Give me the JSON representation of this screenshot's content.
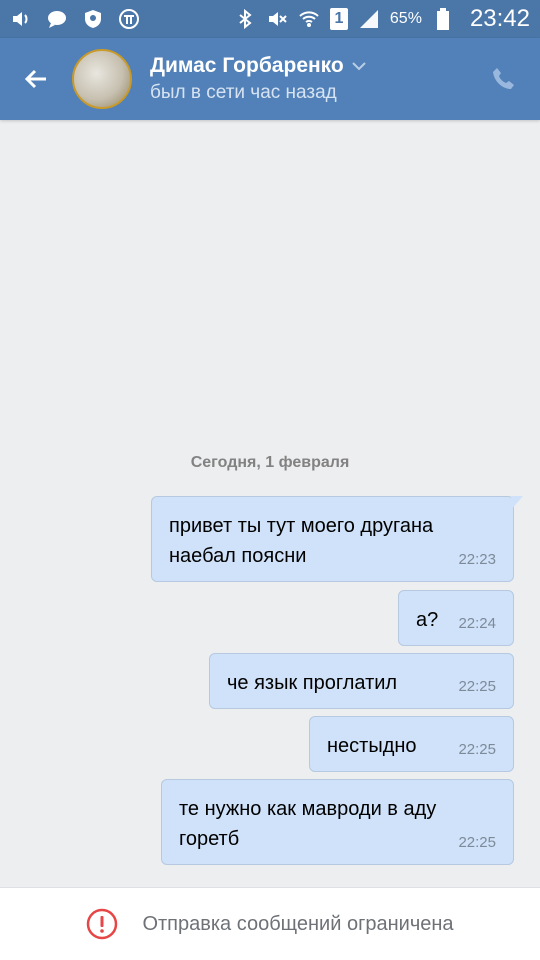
{
  "status_bar": {
    "battery_percent": "65%",
    "time": "23:42",
    "sim_label": "1",
    "icons": [
      "volume-icon",
      "chat-icon",
      "shield-icon",
      "pi-icon",
      "bluetooth-icon",
      "mute-icon",
      "wifi-icon",
      "sim-icon",
      "signal-icon",
      "battery-icon"
    ]
  },
  "header": {
    "contact_name": "Димас Горбаренко",
    "last_seen": "был в сети час назад"
  },
  "chat": {
    "date_separator": "Сегодня, 1 февраля",
    "messages": [
      {
        "text": "привет ты тут моего другана\nнаебал поясни",
        "time": "22:23"
      },
      {
        "text": "а?",
        "time": "22:24"
      },
      {
        "text": "че язык проглатил",
        "time": "22:25"
      },
      {
        "text": "нестыдно",
        "time": "22:25"
      },
      {
        "text": "те нужно как мавроди в аду\nгоретб",
        "time": "22:25"
      }
    ]
  },
  "footer": {
    "restriction_text": "Отправка сообщений ограничена"
  },
  "colors": {
    "accent": "#5181b8",
    "bubble": "#cfe2f9",
    "alert": "#e64646"
  }
}
